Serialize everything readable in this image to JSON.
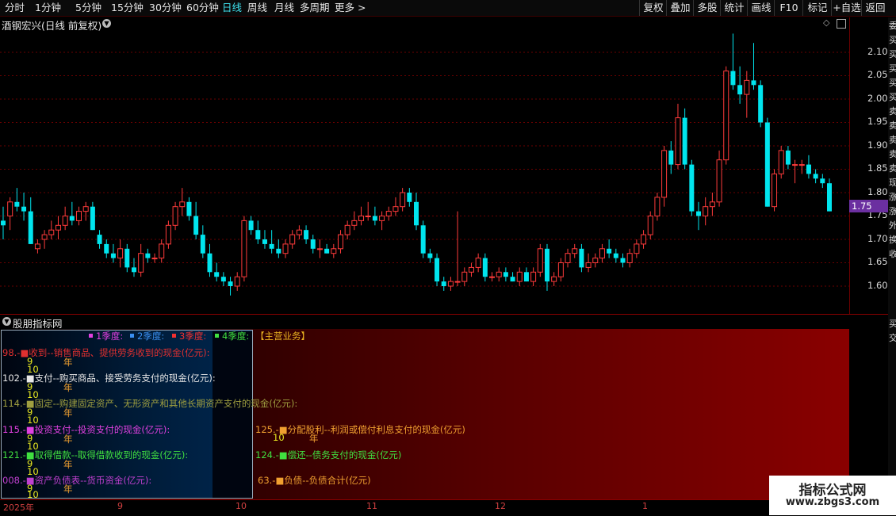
{
  "toolbar": {
    "periods": [
      "分时",
      "1分钟",
      "5分钟",
      "15分钟",
      "30分钟",
      "60分钟",
      "日线",
      "周线",
      "月线",
      "多周期",
      "更多 >"
    ],
    "active_period": "日线",
    "buttons": [
      "复权",
      "叠加",
      "多股",
      "统计",
      "画线",
      "F10",
      "标记",
      "+自选",
      "返回"
    ]
  },
  "chart_header": {
    "title": "酒钢宏兴(日线 前复权)",
    "expand_icon": "chevron-down-icon"
  },
  "price_axis": {
    "labels": [
      "2.10",
      "2.05",
      "2.00",
      "1.95",
      "1.90",
      "1.85",
      "1.80",
      "1.75",
      "1.70",
      "1.65",
      "1.60"
    ],
    "current_price": "1.75"
  },
  "right_strip_chars": [
    "委",
    "买",
    "买",
    "买",
    "买",
    "买",
    "卖",
    "卖",
    "卖",
    "卖",
    "卖",
    "现",
    "涨",
    "涨",
    "外",
    "换",
    "收",
    "买",
    "交"
  ],
  "indicator_panel": {
    "title": "股朋指标网",
    "legend": [
      "1季度:",
      "2季度:",
      "3季度:",
      "4季度:"
    ],
    "legend_colors": [
      "#e040e0",
      "#3a8ff0",
      "#f03030",
      "#40e040"
    ],
    "main_business": "【主营业务】",
    "items": [
      {
        "text": "98.-■收到--销售商品、提供劳务收到的现金(亿元):",
        "color": "#e03030"
      },
      {
        "text": "102.-■支付--购买商品、接受劳务支付的现金(亿元):",
        "color": "#e8e8e8"
      },
      {
        "text": "114.-■固定--购建固定资产、无形资产和其他长期资产支付的现金(亿元):",
        "color": "#a0a040"
      },
      {
        "text": "115.-■投资支付--投资支付的现金(亿元):",
        "color": "#e040e0"
      },
      {
        "text": "121.-■取得借款--取得借款收到的现金(亿元):",
        "color": "#40e040"
      },
      {
        "text": "008.-■资产负债表--货币资金(亿元):",
        "color": "#c040d0"
      },
      {
        "text": "125.-■分配股利--利润或偿付利息支付的现金(亿元)",
        "color": "#f0a030"
      },
      {
        "text": "124.-■偿还--债务支付的现金(亿元)",
        "color": "#40e040"
      },
      {
        "text": "63.-■负债--负债合计(亿元)",
        "color": "#f0a030"
      }
    ],
    "nine": "9",
    "ten": "10",
    "year": "年"
  },
  "date_axis": [
    "2025年",
    "9",
    "10",
    "11",
    "12",
    "1"
  ],
  "watermark": {
    "line1": "指标公式网",
    "line2": "www.zbgs3.com"
  },
  "colors": {
    "up": "#ff3b3b",
    "down": "#00e5ee",
    "grid": "#6a0000"
  },
  "chart_data": {
    "type": "candlestick",
    "title": "酒钢宏兴(日线 前复权)",
    "ylim": [
      1.56,
      2.15
    ],
    "candles": [
      [
        1.74,
        1.77,
        1.7,
        1.73
      ],
      [
        1.75,
        1.79,
        1.72,
        1.78
      ],
      [
        1.78,
        1.81,
        1.76,
        1.77
      ],
      [
        1.77,
        1.8,
        1.74,
        1.76
      ],
      [
        1.76,
        1.79,
        1.69,
        1.69
      ],
      [
        1.68,
        1.7,
        1.67,
        1.69
      ],
      [
        1.7,
        1.72,
        1.68,
        1.71
      ],
      [
        1.71,
        1.74,
        1.7,
        1.72
      ],
      [
        1.72,
        1.75,
        1.7,
        1.73
      ],
      [
        1.73,
        1.77,
        1.72,
        1.75
      ],
      [
        1.75,
        1.78,
        1.73,
        1.74
      ],
      [
        1.74,
        1.77,
        1.73,
        1.76
      ],
      [
        1.76,
        1.78,
        1.74,
        1.77
      ],
      [
        1.77,
        1.78,
        1.72,
        1.72
      ],
      [
        1.71,
        1.72,
        1.68,
        1.69
      ],
      [
        1.69,
        1.7,
        1.66,
        1.67
      ],
      [
        1.67,
        1.69,
        1.65,
        1.66
      ],
      [
        1.66,
        1.7,
        1.64,
        1.68
      ],
      [
        1.68,
        1.69,
        1.63,
        1.64
      ],
      [
        1.64,
        1.66,
        1.62,
        1.63
      ],
      [
        1.63,
        1.69,
        1.62,
        1.67
      ],
      [
        1.67,
        1.68,
        1.65,
        1.66
      ],
      [
        1.66,
        1.67,
        1.65,
        1.66
      ],
      [
        1.66,
        1.7,
        1.65,
        1.69
      ],
      [
        1.69,
        1.74,
        1.68,
        1.73
      ],
      [
        1.73,
        1.78,
        1.72,
        1.77
      ],
      [
        1.77,
        1.81,
        1.75,
        1.78
      ],
      [
        1.78,
        1.79,
        1.74,
        1.75
      ],
      [
        1.75,
        1.78,
        1.7,
        1.71
      ],
      [
        1.71,
        1.73,
        1.66,
        1.67
      ],
      [
        1.67,
        1.69,
        1.62,
        1.63
      ],
      [
        1.63,
        1.65,
        1.61,
        1.62
      ],
      [
        1.62,
        1.63,
        1.6,
        1.61
      ],
      [
        1.61,
        1.62,
        1.58,
        1.6
      ],
      [
        1.6,
        1.63,
        1.59,
        1.62
      ],
      [
        1.62,
        1.75,
        1.61,
        1.74
      ],
      [
        1.74,
        1.75,
        1.71,
        1.72
      ],
      [
        1.72,
        1.74,
        1.69,
        1.7
      ],
      [
        1.7,
        1.72,
        1.68,
        1.69
      ],
      [
        1.69,
        1.72,
        1.67,
        1.68
      ],
      [
        1.68,
        1.7,
        1.66,
        1.67
      ],
      [
        1.67,
        1.7,
        1.66,
        1.69
      ],
      [
        1.69,
        1.72,
        1.68,
        1.71
      ],
      [
        1.71,
        1.73,
        1.7,
        1.72
      ],
      [
        1.72,
        1.73,
        1.69,
        1.7
      ],
      [
        1.7,
        1.71,
        1.67,
        1.68
      ],
      [
        1.68,
        1.7,
        1.66,
        1.68
      ],
      [
        1.68,
        1.69,
        1.67,
        1.67
      ],
      [
        1.67,
        1.69,
        1.66,
        1.68
      ],
      [
        1.68,
        1.72,
        1.67,
        1.71
      ],
      [
        1.71,
        1.74,
        1.7,
        1.73
      ],
      [
        1.73,
        1.76,
        1.72,
        1.74
      ],
      [
        1.74,
        1.77,
        1.73,
        1.75
      ],
      [
        1.75,
        1.78,
        1.74,
        1.75
      ],
      [
        1.75,
        1.77,
        1.73,
        1.74
      ],
      [
        1.74,
        1.76,
        1.72,
        1.75
      ],
      [
        1.75,
        1.77,
        1.74,
        1.76
      ],
      [
        1.76,
        1.79,
        1.75,
        1.77
      ],
      [
        1.77,
        1.81,
        1.76,
        1.8
      ],
      [
        1.8,
        1.81,
        1.77,
        1.78
      ],
      [
        1.78,
        1.8,
        1.72,
        1.73
      ],
      [
        1.73,
        1.74,
        1.66,
        1.67
      ],
      [
        1.67,
        1.68,
        1.65,
        1.66
      ],
      [
        1.66,
        1.67,
        1.6,
        1.61
      ],
      [
        1.61,
        1.62,
        1.59,
        1.6
      ],
      [
        1.6,
        1.62,
        1.59,
        1.61
      ],
      [
        1.61,
        1.76,
        1.6,
        1.61
      ],
      [
        1.61,
        1.64,
        1.6,
        1.63
      ],
      [
        1.63,
        1.65,
        1.62,
        1.64
      ],
      [
        1.64,
        1.67,
        1.63,
        1.66
      ],
      [
        1.66,
        1.67,
        1.61,
        1.62
      ],
      [
        1.62,
        1.63,
        1.61,
        1.62
      ],
      [
        1.62,
        1.64,
        1.61,
        1.63
      ],
      [
        1.63,
        1.64,
        1.61,
        1.62
      ],
      [
        1.62,
        1.63,
        1.61,
        1.61
      ],
      [
        1.61,
        1.64,
        1.6,
        1.63
      ],
      [
        1.63,
        1.64,
        1.61,
        1.61
      ],
      [
        1.61,
        1.64,
        1.6,
        1.63
      ],
      [
        1.63,
        1.69,
        1.62,
        1.68
      ],
      [
        1.68,
        1.69,
        1.59,
        1.61
      ],
      [
        1.61,
        1.63,
        1.6,
        1.62
      ],
      [
        1.62,
        1.66,
        1.61,
        1.65
      ],
      [
        1.65,
        1.68,
        1.64,
        1.67
      ],
      [
        1.67,
        1.69,
        1.66,
        1.68
      ],
      [
        1.68,
        1.69,
        1.63,
        1.64
      ],
      [
        1.64,
        1.67,
        1.63,
        1.65
      ],
      [
        1.65,
        1.67,
        1.64,
        1.66
      ],
      [
        1.66,
        1.69,
        1.65,
        1.68
      ],
      [
        1.68,
        1.7,
        1.66,
        1.67
      ],
      [
        1.67,
        1.68,
        1.65,
        1.66
      ],
      [
        1.66,
        1.67,
        1.64,
        1.65
      ],
      [
        1.65,
        1.68,
        1.64,
        1.67
      ],
      [
        1.67,
        1.7,
        1.66,
        1.69
      ],
      [
        1.69,
        1.72,
        1.68,
        1.71
      ],
      [
        1.71,
        1.76,
        1.7,
        1.75
      ],
      [
        1.75,
        1.8,
        1.74,
        1.79
      ],
      [
        1.79,
        1.9,
        1.77,
        1.89
      ],
      [
        1.89,
        1.91,
        1.84,
        1.86
      ],
      [
        1.86,
        1.99,
        1.85,
        1.96
      ],
      [
        1.96,
        1.98,
        1.85,
        1.86
      ],
      [
        1.86,
        1.87,
        1.75,
        1.76
      ],
      [
        1.76,
        1.78,
        1.72,
        1.75
      ],
      [
        1.75,
        1.79,
        1.73,
        1.77
      ],
      [
        1.77,
        1.8,
        1.75,
        1.78
      ],
      [
        1.78,
        1.89,
        1.77,
        1.87
      ],
      [
        1.87,
        2.07,
        1.86,
        2.06
      ],
      [
        2.06,
        2.14,
        2.02,
        2.03
      ],
      [
        2.03,
        2.07,
        1.99,
        2.01
      ],
      [
        2.01,
        2.06,
        1.96,
        2.04
      ],
      [
        2.04,
        2.12,
        2.02,
        2.03
      ],
      [
        2.03,
        2.04,
        1.94,
        1.95
      ],
      [
        1.95,
        1.96,
        1.77,
        1.77
      ],
      [
        1.77,
        1.85,
        1.76,
        1.84
      ],
      [
        1.84,
        1.9,
        1.83,
        1.89
      ],
      [
        1.89,
        1.9,
        1.85,
        1.86
      ],
      [
        1.86,
        1.87,
        1.82,
        1.86
      ],
      [
        1.86,
        1.87,
        1.84,
        1.86
      ],
      [
        1.86,
        1.88,
        1.83,
        1.84
      ],
      [
        1.84,
        1.85,
        1.82,
        1.83
      ],
      [
        1.83,
        1.84,
        1.81,
        1.82
      ],
      [
        1.82,
        1.83,
        1.76,
        1.76
      ]
    ]
  }
}
